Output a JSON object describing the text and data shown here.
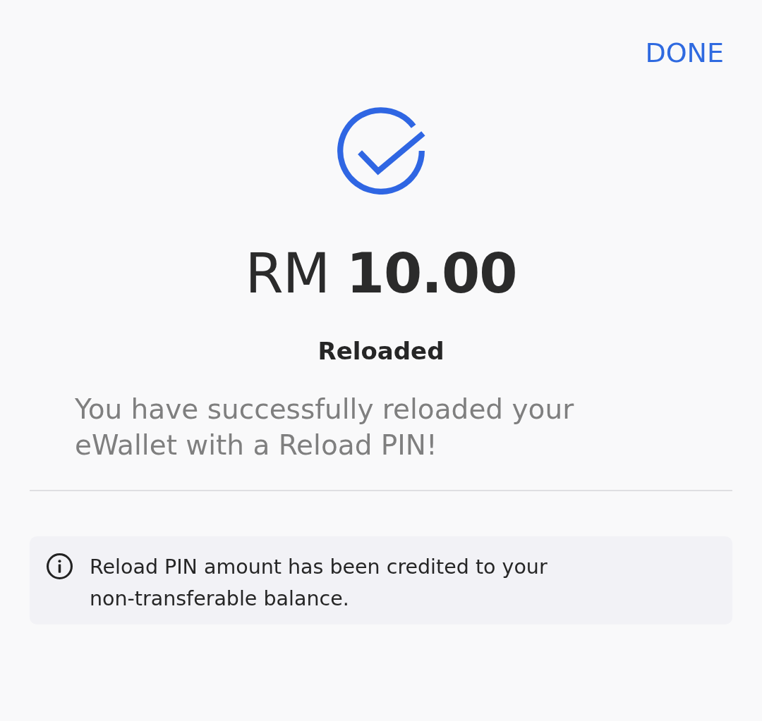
{
  "header": {
    "done_button": "DONE"
  },
  "result": {
    "amount": "RM **10.00**",
    "status": "Reloaded",
    "message": "You have successfully reloaded your eWallet with a Reload PIN!"
  },
  "notice": {
    "text": "Reload PIN amount has been credited to your non-transferable balance."
  }
}
